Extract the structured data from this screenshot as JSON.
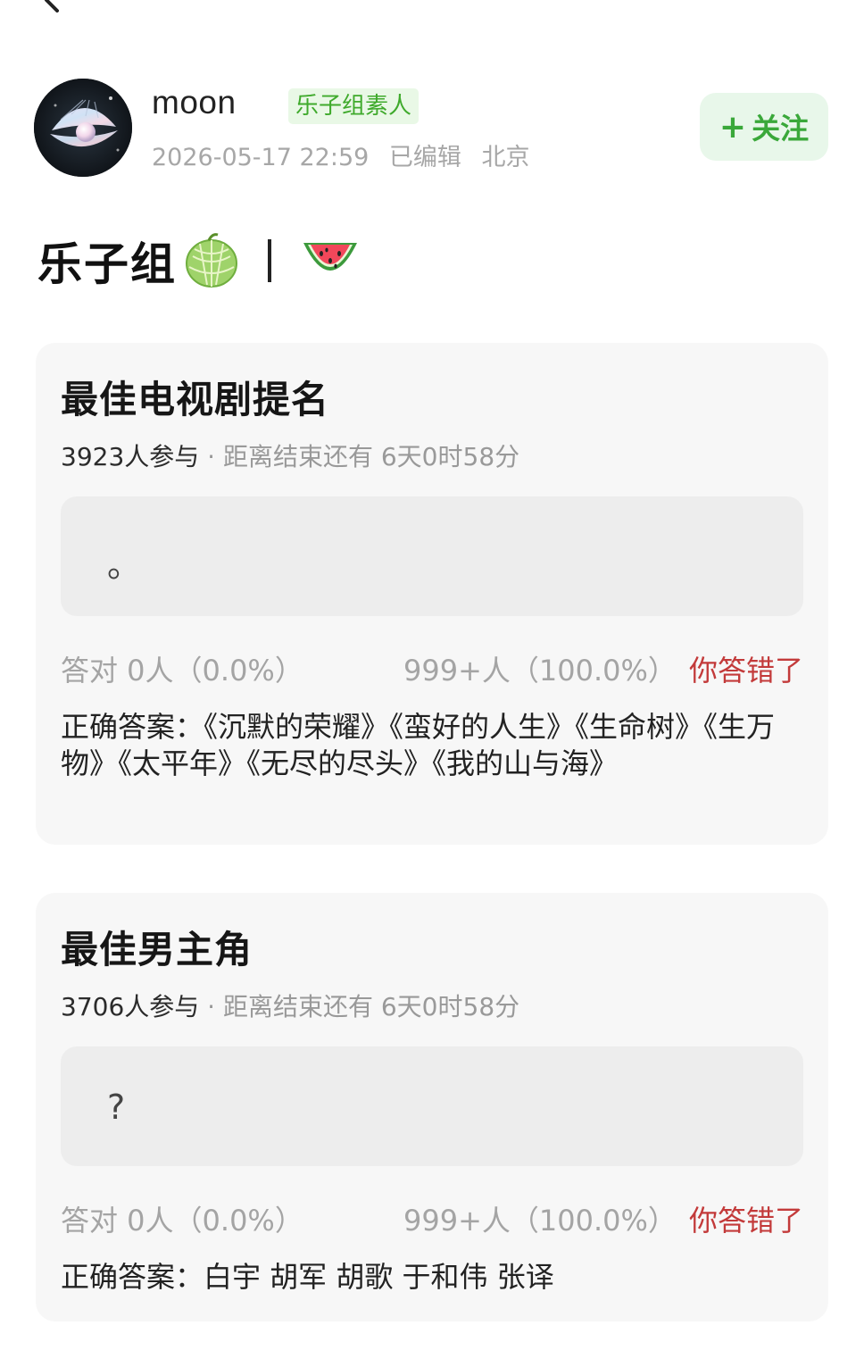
{
  "author": {
    "name": "moon",
    "tag": "乐子组素人",
    "timestamp": "2026-05-17 22:59",
    "edited": "已编辑",
    "location": "北京"
  },
  "follow": {
    "plus": "+",
    "label": "关注"
  },
  "post": {
    "title_text": "乐子组",
    "emoji_1": "melon-icon",
    "emoji_2": "watermelon-icon"
  },
  "polls": [
    {
      "title": "最佳电视剧提名",
      "participants": "3923人参与",
      "separator": " · ",
      "deadline": "距离结束还有 6天0时58分",
      "my_answer": "。",
      "correct_count": "答对  0人（0.0%）",
      "wrong_count": "999+人（100.0%）",
      "result_label": "你答错了",
      "correct_answer": "正确答案：《沉默的荣耀》《蛮好的人生》《生命树》《生万物》《太平年》《无尽的尽头》《我的山与海》"
    },
    {
      "title": "最佳男主角",
      "participants": "3706人参与",
      "separator": " · ",
      "deadline": "距离结束还有 6天0时58分",
      "my_answer": "?",
      "correct_count": "答对  0人（0.0%）",
      "wrong_count": "999+人（100.0%）",
      "result_label": "你答错了",
      "correct_answer": "正确答案：白宇 胡军 胡歌 于和伟 张译"
    }
  ],
  "colors": {
    "accent_green": "#3aa83a",
    "tag_bg": "#e9f8e6",
    "wrong_red": "#c33a3a",
    "card_bg": "#f7f7f7"
  }
}
